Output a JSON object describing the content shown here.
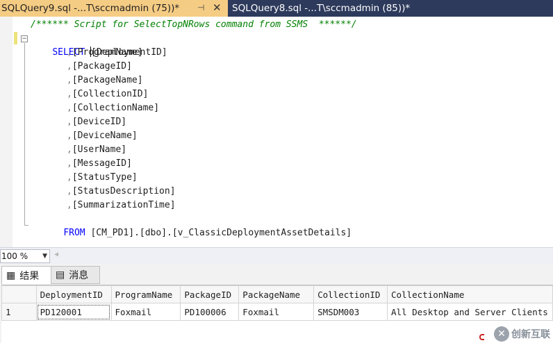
{
  "tabs": [
    {
      "label": "SQLQuery9.sql -...T\\sccmadmin (75))*",
      "active": true
    },
    {
      "label": "SQLQuery8.sql -...T\\sccmadmin (85))*",
      "active": false
    }
  ],
  "tab_pin_glyph": "⊣",
  "tab_close_glyph": "✕",
  "editor": {
    "comment": "/****** Script for SelectTopNRows command from SSMS  ******/",
    "select_keyword": "SELECT",
    "first_column": "[DeploymentID]",
    "columns": [
      ",[ProgramName]",
      ",[PackageID]",
      ",[PackageName]",
      ",[CollectionID]",
      ",[CollectionName]",
      ",[DeviceID]",
      ",[DeviceName]",
      ",[UserName]",
      ",[MessageID]",
      ",[StatusType]",
      ",[StatusDescription]",
      ",[SummarizationTime]"
    ],
    "from_keyword": "FROM",
    "from_source": "[CM_PD1].[dbo].[v_ClassicDeploymentAssetDetails]"
  },
  "zoom": {
    "value": "100 %"
  },
  "results_tabs": [
    {
      "label": "结果",
      "icon": "grid-icon",
      "active": true
    },
    {
      "label": "消息",
      "icon": "messages-icon",
      "active": false
    }
  ],
  "grid": {
    "headers": [
      "DeploymentID",
      "ProgramName",
      "PackageID",
      "PackageName",
      "CollectionID",
      "CollectionName"
    ],
    "rows": [
      {
        "num": "1",
        "cells": [
          "PD120001",
          "Foxmail",
          "PD100006",
          "Foxmail",
          "SMSDM003",
          "All Desktop and Server Clients"
        ]
      }
    ]
  },
  "watermark": {
    "text": "创新互联"
  }
}
